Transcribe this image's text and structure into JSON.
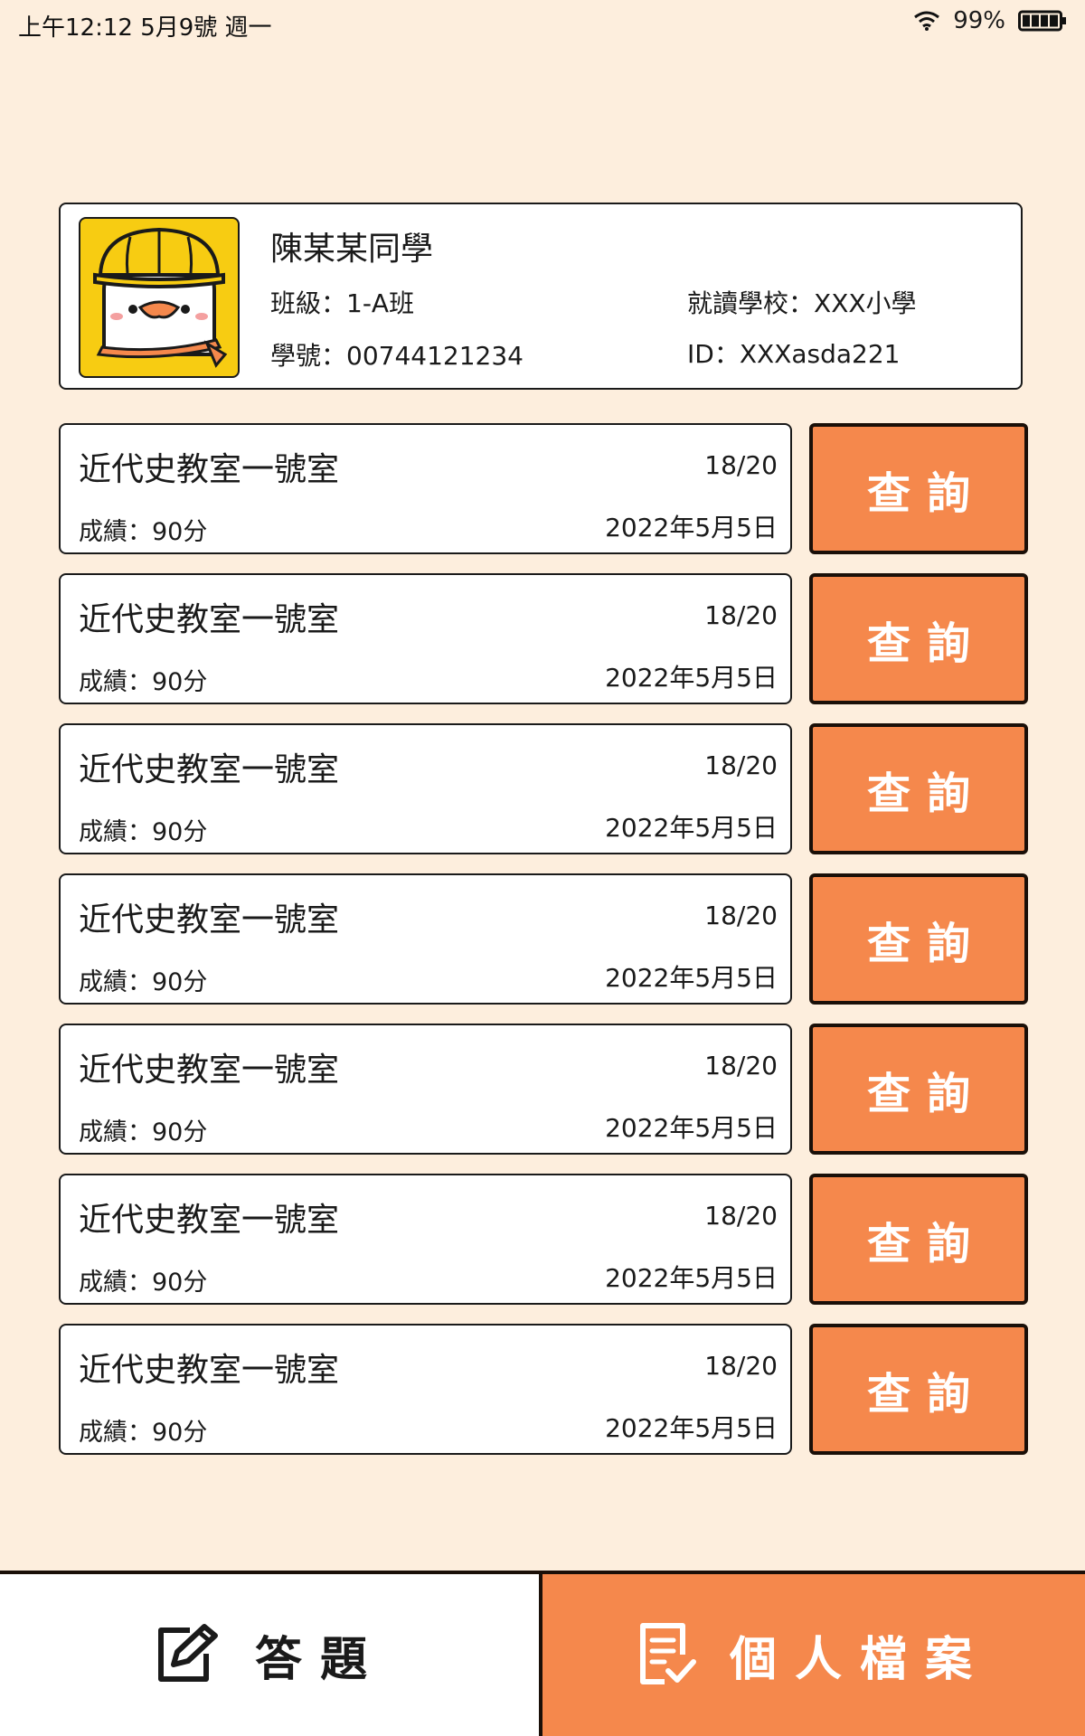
{
  "status_bar": {
    "time": "上午12:12  5月9號 週一",
    "battery": "99%"
  },
  "student": {
    "name": "陳某某同學",
    "class_label": "班級：",
    "class_value": "1-A班",
    "school_label": "就讀學校：",
    "school_value": "XXX小學",
    "student_no_label": "學號：",
    "student_no_value": "00744121234",
    "id_label": "ID：",
    "id_value": "XXXasda221"
  },
  "records": [
    {
      "title": "近代史教室一號室",
      "score": "18/20",
      "grade": "成績：90分",
      "date": "2022年5月5日",
      "button": "查詢"
    },
    {
      "title": "近代史教室一號室",
      "score": "18/20",
      "grade": "成績：90分",
      "date": "2022年5月5日",
      "button": "查詢"
    },
    {
      "title": "近代史教室一號室",
      "score": "18/20",
      "grade": "成績：90分",
      "date": "2022年5月5日",
      "button": "查詢"
    },
    {
      "title": "近代史教室一號室",
      "score": "18/20",
      "grade": "成績：90分",
      "date": "2022年5月5日",
      "button": "查詢"
    },
    {
      "title": "近代史教室一號室",
      "score": "18/20",
      "grade": "成績：90分",
      "date": "2022年5月5日",
      "button": "查詢"
    },
    {
      "title": "近代史教室一號室",
      "score": "18/20",
      "grade": "成績：90分",
      "date": "2022年5月5日",
      "button": "查詢"
    },
    {
      "title": "近代史教室一號室",
      "score": "18/20",
      "grade": "成績：90分",
      "date": "2022年5月5日",
      "button": "查詢"
    }
  ],
  "bottom_nav": {
    "answer_label": "答題",
    "answer_icon": "edit-icon",
    "profile_label": "個人檔案",
    "profile_icon": "document-check-icon"
  },
  "colors": {
    "background": "#fdeedd",
    "accent": "#f5884c",
    "avatar_bg": "#f7cc12"
  }
}
